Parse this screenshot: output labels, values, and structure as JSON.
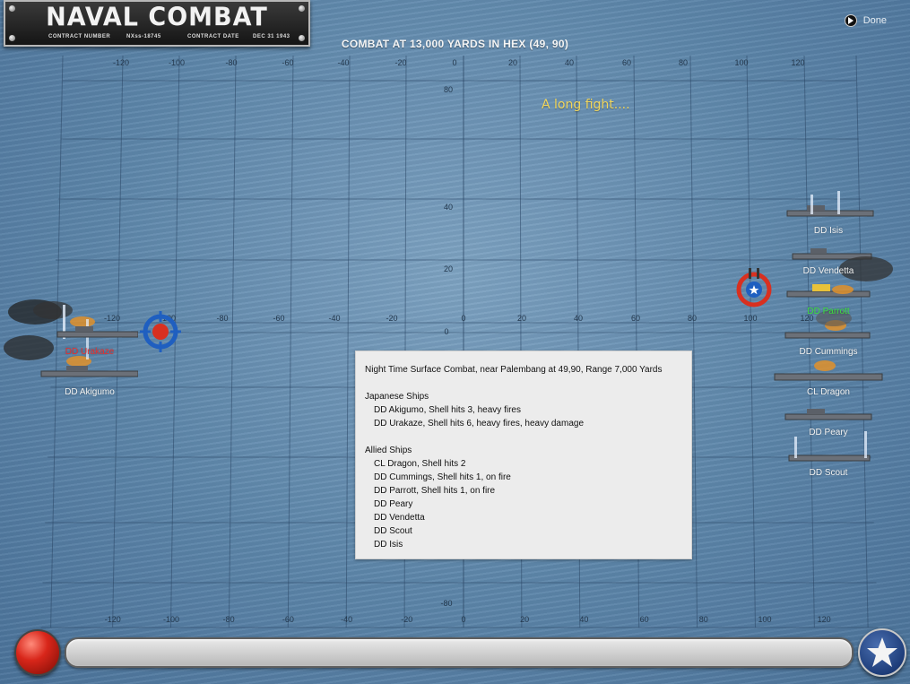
{
  "header": {
    "title": "NAVAL COMBAT",
    "contract_number_label": "CONTRACT NUMBER",
    "contract_number": "NXss-18745",
    "contract_date_label": "CONTRACT DATE",
    "contract_date": "DEC 31 1943"
  },
  "done_label": "Done",
  "headline": "COMBAT AT 13,000 YARDS IN HEX (49, 90)",
  "narrative": "A long fight....",
  "axis": {
    "x_ticks": [
      "-120",
      "-100",
      "-80",
      "-60",
      "-40",
      "-20",
      "0",
      "20",
      "40",
      "60",
      "80",
      "100",
      "120"
    ],
    "y_ticks": [
      "80",
      "40",
      "20",
      "0",
      "-80"
    ]
  },
  "japanese_ships": [
    {
      "name": "DD Urakaze",
      "color": "#e83030"
    },
    {
      "name": "DD Akigumo",
      "color": "#f2f2f2"
    }
  ],
  "allied_ships": [
    {
      "name": "DD Isis",
      "color": "#f2f2f2"
    },
    {
      "name": "DD Vendetta",
      "color": "#f2f2f2"
    },
    {
      "name": "DD Parrott",
      "color": "#3ee03e"
    },
    {
      "name": "DD Cummings",
      "color": "#f2f2f2"
    },
    {
      "name": "CL Dragon",
      "color": "#f2f2f2"
    },
    {
      "name": "DD Peary",
      "color": "#f2f2f2"
    },
    {
      "name": "DD Scout",
      "color": "#f2f2f2"
    }
  ],
  "report": {
    "title": "Night Time Surface Combat, near Palembang at 49,90, Range 7,000 Yards",
    "japanese_header": "Japanese Ships",
    "japanese_lines": [
      "DD Akigumo, Shell hits 3,  heavy fires",
      "DD Urakaze, Shell hits 6,  heavy fires,  heavy damage"
    ],
    "allied_header": "Allied Ships",
    "allied_lines": [
      "CL Dragon, Shell hits 2",
      "DD Cummings, Shell hits 1,  on fire",
      "DD Parrott, Shell hits 1,  on fire",
      "DD Peary",
      "DD Vendetta",
      "DD Scout",
      "DD Isis"
    ]
  },
  "colors": {
    "sea": "#5f86a8",
    "grid": "#2c4766",
    "narrative": "#f1d65c",
    "target_blue": "#1f5fc0",
    "target_red": "#d83020"
  },
  "icons": [
    "done-icon",
    "target-reticle-icon",
    "allied-target-reticle-icon",
    "star-icon",
    "fire-button"
  ]
}
